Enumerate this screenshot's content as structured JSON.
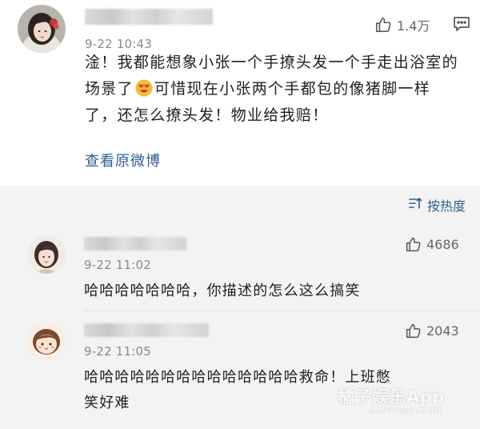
{
  "main_comment": {
    "time": "9-22 10:43",
    "likes": "1.4万",
    "text_part1": "淦！我都能想象小张一个手撩头发一个手走出浴室的场景了",
    "text_part2": "可惜现在小张两个手都包的像猪脚一样了，还怎么撩头发！物业给我赔！",
    "emoji_icon": "heart-eyes-emoji-icon",
    "view_original": "查看原微博"
  },
  "replies_panel": {
    "sort_label": "按热度",
    "items": [
      {
        "time": "9-22 11:02",
        "likes": "4686",
        "text": "哈哈哈哈哈哈哈，你描述的怎么这么搞笑"
      },
      {
        "time": "9-22 11:05",
        "likes": "2043",
        "text_line1": "哈哈哈哈哈哈哈哈哈哈哈哈哈哈救命！上班憋",
        "text_line2": "笑好难"
      }
    ]
  },
  "watermark": {
    "brand": "橘子娱乐App",
    "sub": "HAPPYJUZI.COM"
  },
  "colors": {
    "link": "#2f5f8f",
    "reply_bg": "#f3f3f3",
    "meta": "#8a8a8a"
  }
}
